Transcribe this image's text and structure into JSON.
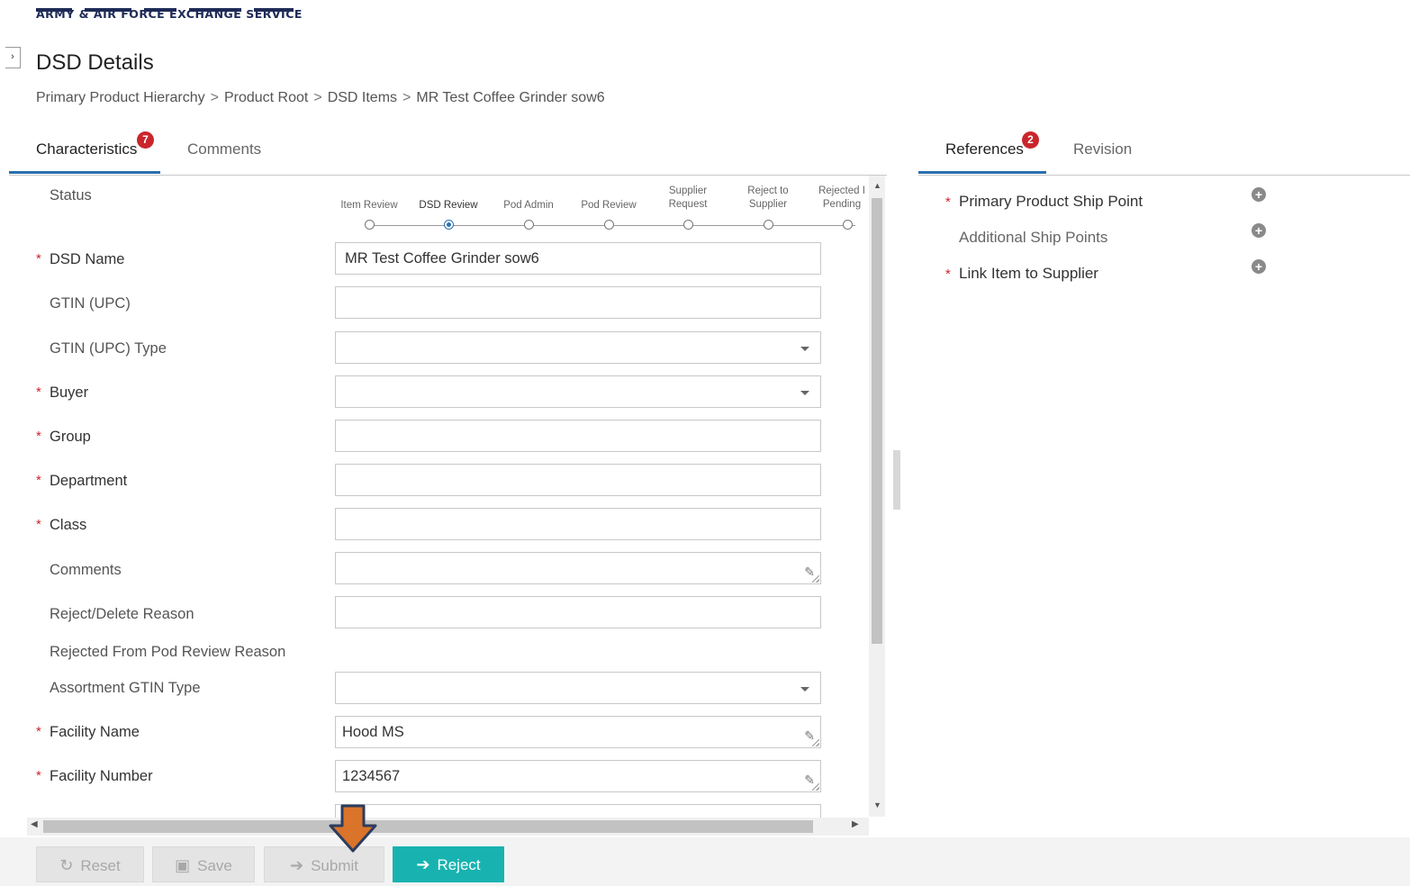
{
  "logo": {
    "org_name": "ARMY & AIR FORCE EXCHANGE SERVICE"
  },
  "page": {
    "title": "DSD Details"
  },
  "breadcrumb": [
    "Primary Product Hierarchy",
    "Product Root",
    "DSD Items",
    "MR Test Coffee Grinder sow6"
  ],
  "breadcrumb_separator": ">",
  "left_tabs": [
    {
      "label": "Characteristics",
      "badge": "7",
      "active": true
    },
    {
      "label": "Comments",
      "active": false
    }
  ],
  "right_tabs": [
    {
      "label": "References",
      "badge": "2",
      "active": true
    },
    {
      "label": "Revision",
      "active": false
    }
  ],
  "status": {
    "label": "Status",
    "steps": [
      "Item Review",
      "DSD Review",
      "Pod Admin",
      "Pod Review",
      "Supplier Request",
      "Reject to Supplier",
      "Rejected I Pending"
    ],
    "active_index": 1
  },
  "fields": {
    "dsd_name": {
      "label": "DSD Name",
      "value": "MR Test Coffee Grinder sow6",
      "required": true
    },
    "gtin": {
      "label": "GTIN (UPC)",
      "value": ""
    },
    "gtin_type": {
      "label": "GTIN (UPC) Type",
      "value": ""
    },
    "buyer": {
      "label": "Buyer",
      "value": "",
      "required": true
    },
    "group": {
      "label": "Group",
      "value": "",
      "required": true
    },
    "department": {
      "label": "Department",
      "value": "",
      "required": true
    },
    "class": {
      "label": "Class",
      "value": "",
      "required": true
    },
    "comments": {
      "label": "Comments",
      "value": ""
    },
    "reject_reason": {
      "label": "Reject/Delete Reason",
      "value": ""
    },
    "rejected_pod_reason": {
      "label": "Rejected From Pod Review Reason"
    },
    "assortment_gtin_type": {
      "label": "Assortment GTIN Type",
      "value": ""
    },
    "facility_name": {
      "label": "Facility Name",
      "value": "Hood MS",
      "required": true
    },
    "facility_number": {
      "label": "Facility Number",
      "value": "1234567",
      "required": true
    }
  },
  "required_marker": "*",
  "references": [
    {
      "label": "Primary Product Ship Point",
      "required": true
    },
    {
      "label": "Additional Ship Points",
      "required": false
    },
    {
      "label": "Link Item to Supplier",
      "required": true
    }
  ],
  "toolbar": {
    "reset_label": "Reset",
    "save_label": "Save",
    "submit_label": "Submit",
    "reject_label": "Reject"
  },
  "colors": {
    "accent": "#2a6fb0",
    "badge": "#c9262c",
    "primary_button": "#18b3b0",
    "annotation_arrow": "#d9742a"
  }
}
